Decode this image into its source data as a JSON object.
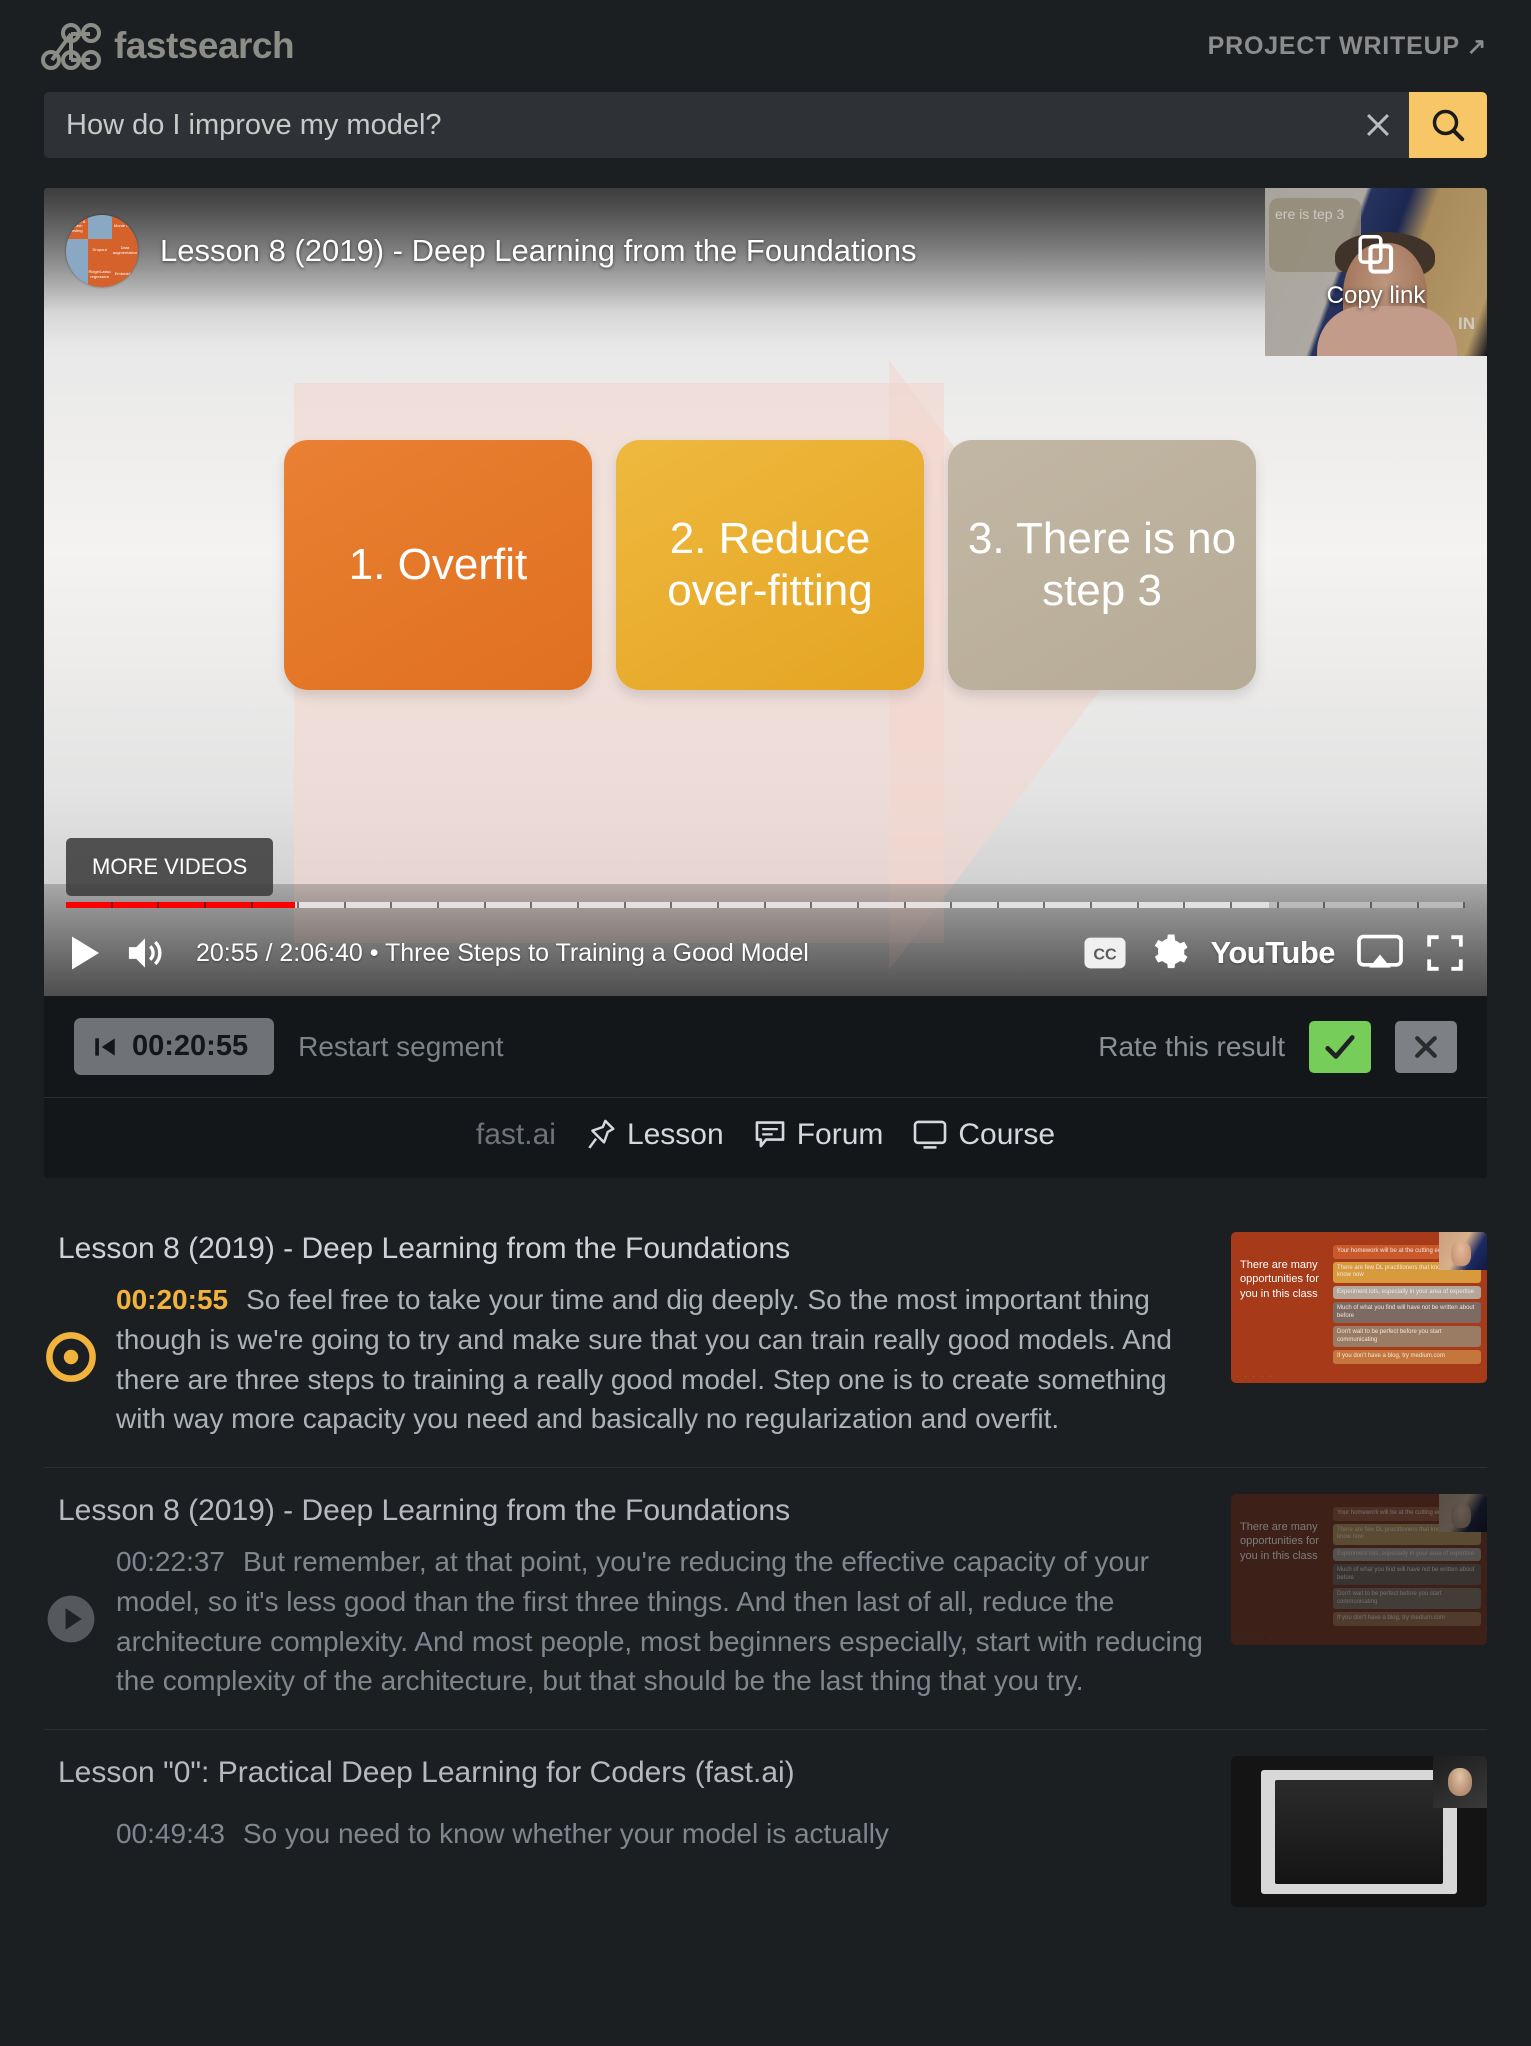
{
  "header": {
    "brand": "fastsearch",
    "brand_icon": "network-graph-icon",
    "writeup_label": "PROJECT WRITEUP",
    "writeup_arrow": "↗"
  },
  "search": {
    "value": "How do I improve my model?",
    "placeholder": "Search",
    "clear_icon": "close-icon",
    "submit_icon": "search-icon",
    "accent": "#f7c667"
  },
  "player": {
    "video_title": "Lesson 8 (2019) - Deep Learning from the Foundations",
    "copy_link_label": "Copy link",
    "copy_link_icon": "copy-icon",
    "more_videos_label": "MORE VIDEOS",
    "slide": {
      "steps": [
        {
          "text": "1. Overfit",
          "color": "#e0701f"
        },
        {
          "text": "2. Reduce over-fitting",
          "color": "#e5a422"
        },
        {
          "text": "3. There is no step 3",
          "color": "#b6ab96"
        }
      ],
      "pip_ghost_text": "ere is tep 3",
      "pip_corner_text": "IN"
    },
    "controls": {
      "play_icon": "play-icon",
      "volume_icon": "volume-icon",
      "time_text": "20:55 / 2:06:40 • Three Steps to Training a Good Model",
      "cc_label": "CC",
      "settings_icon": "gear-icon",
      "youtube_label": "YouTube",
      "cast_icon": "cast-icon",
      "fullscreen_icon": "fullscreen-icon",
      "progress_percent": 16.4,
      "buffered_percent": 86
    }
  },
  "segment_bar": {
    "skip_icon": "skip-previous-icon",
    "timestamp": "00:20:55",
    "restart_label": "Restart segment",
    "rate_label": "Rate this result",
    "rate_yes_icon": "check-icon",
    "rate_no_icon": "close-icon",
    "rate_yes_color": "#76cd5a",
    "rate_no_color": "#7d8084"
  },
  "links": [
    {
      "label": "fast.ai",
      "icon": null,
      "dim": true
    },
    {
      "label": "Lesson",
      "icon": "pin-icon",
      "dim": false
    },
    {
      "label": "Forum",
      "icon": "speech-bubble-icon",
      "dim": false
    },
    {
      "label": "Course",
      "icon": "monitor-icon",
      "dim": false
    }
  ],
  "results": [
    {
      "title": "Lesson 8 (2019) - Deep Learning from the Foundations",
      "timestamp": "00:20:55",
      "text": "So feel free to take your time and dig deeply. So the most important thing though is we're going to try and make sure that you can train really good models. And there are three steps to training a really good model. Step one is to create something with way more capacity you need and basically no regularization and overfit.",
      "state_icon": "current-playing-icon",
      "active": true,
      "thumbnail": {
        "type": "slide-opportunities",
        "title": "There are many opportunities for you in this class",
        "rows": [
          "Your homework will be at the cutting edge",
          "There are few DL practitioners that know what you know now",
          "Experiment lots, especially in your area of expertise",
          "Much of what you find will have not be written about before",
          "Don't wait to be perfect before you start communicating",
          "If you don't have a blog, try medium.com"
        ]
      }
    },
    {
      "title": "Lesson 8 (2019) - Deep Learning from the Foundations",
      "timestamp": "00:22:37",
      "text": "But remember, at that point, you're reducing the effective capacity of your model, so it's less good than the first three things. And then last of all, reduce the architecture complexity. And most people, most beginners especially, start with reducing the complexity of the architecture, but that should be the last thing that you try.",
      "state_icon": "play-circle-icon",
      "active": false,
      "thumbnail": {
        "type": "slide-opportunities",
        "title": "There are many opportunities for you in this class",
        "rows": [
          "Your homework will be at the cutting edge",
          "There are few DL practitioners that know what you know now",
          "Experiment lots, especially in your area of expertise",
          "Much of what you find will have not be written about before",
          "Don't wait to be perfect before you start communicating",
          "If you don't have a blog, try medium.com"
        ]
      }
    },
    {
      "title": "Lesson \"0\": Practical Deep Learning for Coders (fast.ai)",
      "timestamp": "00:49:43",
      "text": "So you need to know whether your model is actually",
      "state_icon": "play-circle-icon",
      "active": false,
      "thumbnail": {
        "type": "screen-dark",
        "title": "",
        "rows": []
      }
    }
  ]
}
